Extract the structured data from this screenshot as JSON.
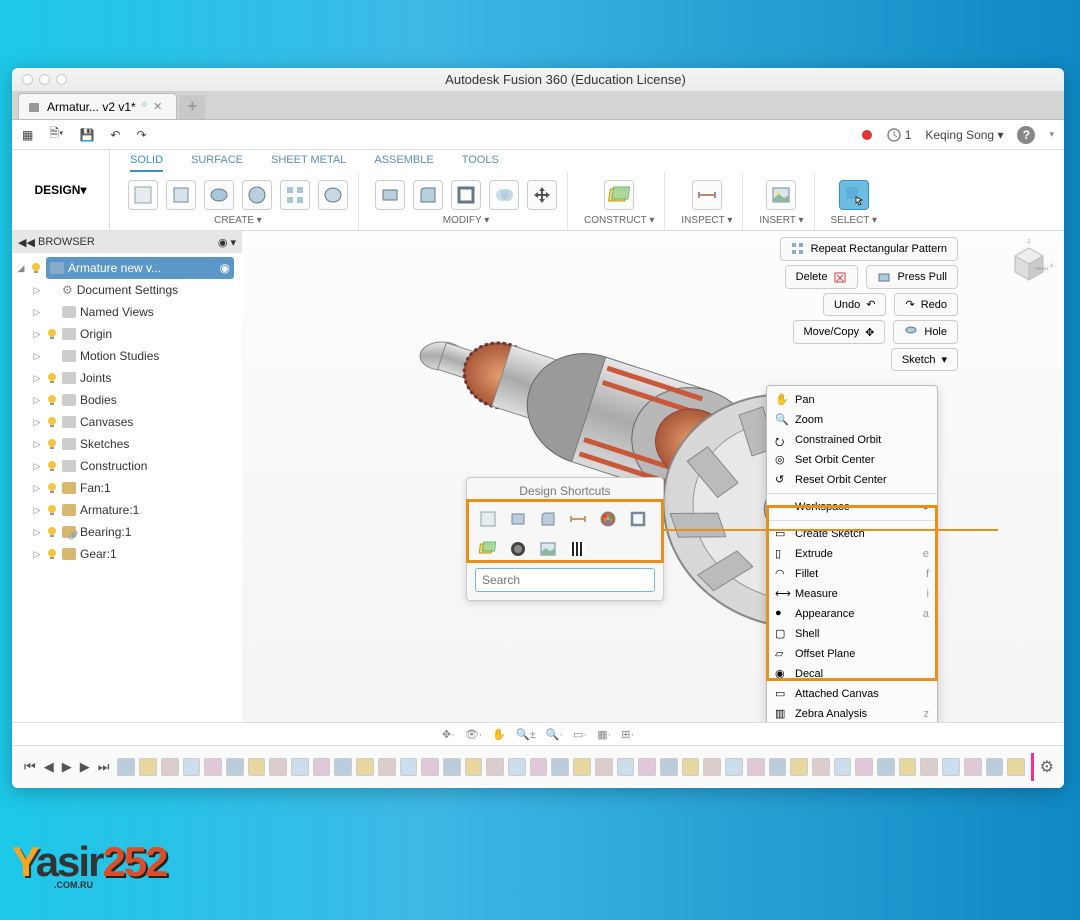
{
  "window": {
    "title": "Autodesk Fusion 360 (Education License)"
  },
  "tab": {
    "name": "Armatur... v2 v1*",
    "dirty": "○"
  },
  "topbar": {
    "extCount": "1",
    "user": "Keqing Song"
  },
  "workspace": {
    "label": "DESIGN"
  },
  "ribbon": {
    "tabs": [
      "SOLID",
      "SURFACE",
      "SHEET METAL",
      "ASSEMBLE",
      "TOOLS"
    ],
    "groups": {
      "create": "CREATE",
      "modify": "MODIFY",
      "construct": "CONSTRUCT",
      "inspect": "INSPECT",
      "insert": "INSERT",
      "select": "SELECT"
    }
  },
  "browser": {
    "title": "BROWSER",
    "root": "Armature new v...",
    "items": [
      {
        "label": "Document Settings",
        "icon": "gear",
        "bulb": "none"
      },
      {
        "label": "Named Views",
        "icon": "folder",
        "bulb": "none"
      },
      {
        "label": "Origin",
        "icon": "folder",
        "bulb": "on"
      },
      {
        "label": "Motion Studies",
        "icon": "folder",
        "bulb": "none"
      },
      {
        "label": "Joints",
        "icon": "folder",
        "bulb": "on"
      },
      {
        "label": "Bodies",
        "icon": "folder",
        "bulb": "on"
      },
      {
        "label": "Canvases",
        "icon": "folder",
        "bulb": "on"
      },
      {
        "label": "Sketches",
        "icon": "folder",
        "bulb": "on"
      },
      {
        "label": "Construction",
        "icon": "folder",
        "bulb": "on"
      },
      {
        "label": "Fan:1",
        "icon": "comp",
        "bulb": "on"
      },
      {
        "label": "Armature:1",
        "icon": "comp",
        "bulb": "on"
      },
      {
        "label": "Bearing:1",
        "icon": "comp-link",
        "bulb": "on"
      },
      {
        "label": "Gear:1",
        "icon": "comp",
        "bulb": "on"
      }
    ]
  },
  "ctxButtons": {
    "repeat": "Repeat Rectangular Pattern",
    "delete": "Delete",
    "press": "Press Pull",
    "undo": "Undo",
    "redo": "Redo",
    "move": "Move/Copy",
    "hole": "Hole",
    "sketch": "Sketch"
  },
  "contextMenu": {
    "nav": [
      {
        "label": "Pan"
      },
      {
        "label": "Zoom"
      },
      {
        "label": "Constrained Orbit"
      },
      {
        "label": "Set Orbit Center"
      },
      {
        "label": "Reset Orbit Center"
      }
    ],
    "workspace": "Workspace",
    "tools": [
      {
        "label": "Create Sketch",
        "key": ""
      },
      {
        "label": "Extrude",
        "key": "e"
      },
      {
        "label": "Fillet",
        "key": "f"
      },
      {
        "label": "Measure",
        "key": "i"
      },
      {
        "label": "Appearance",
        "key": "a"
      },
      {
        "label": "Shell",
        "key": ""
      },
      {
        "label": "Offset Plane",
        "key": ""
      },
      {
        "label": "Decal",
        "key": ""
      },
      {
        "label": "Attached Canvas",
        "key": ""
      },
      {
        "label": "Zebra Analysis",
        "key": "z"
      }
    ]
  },
  "shortcuts": {
    "title": "Design Shortcuts",
    "searchPlaceholder": "Search"
  },
  "logo": {
    "part1": "Y",
    "part2": "asir",
    "part3": "252",
    "sub": ".COM.RU"
  }
}
